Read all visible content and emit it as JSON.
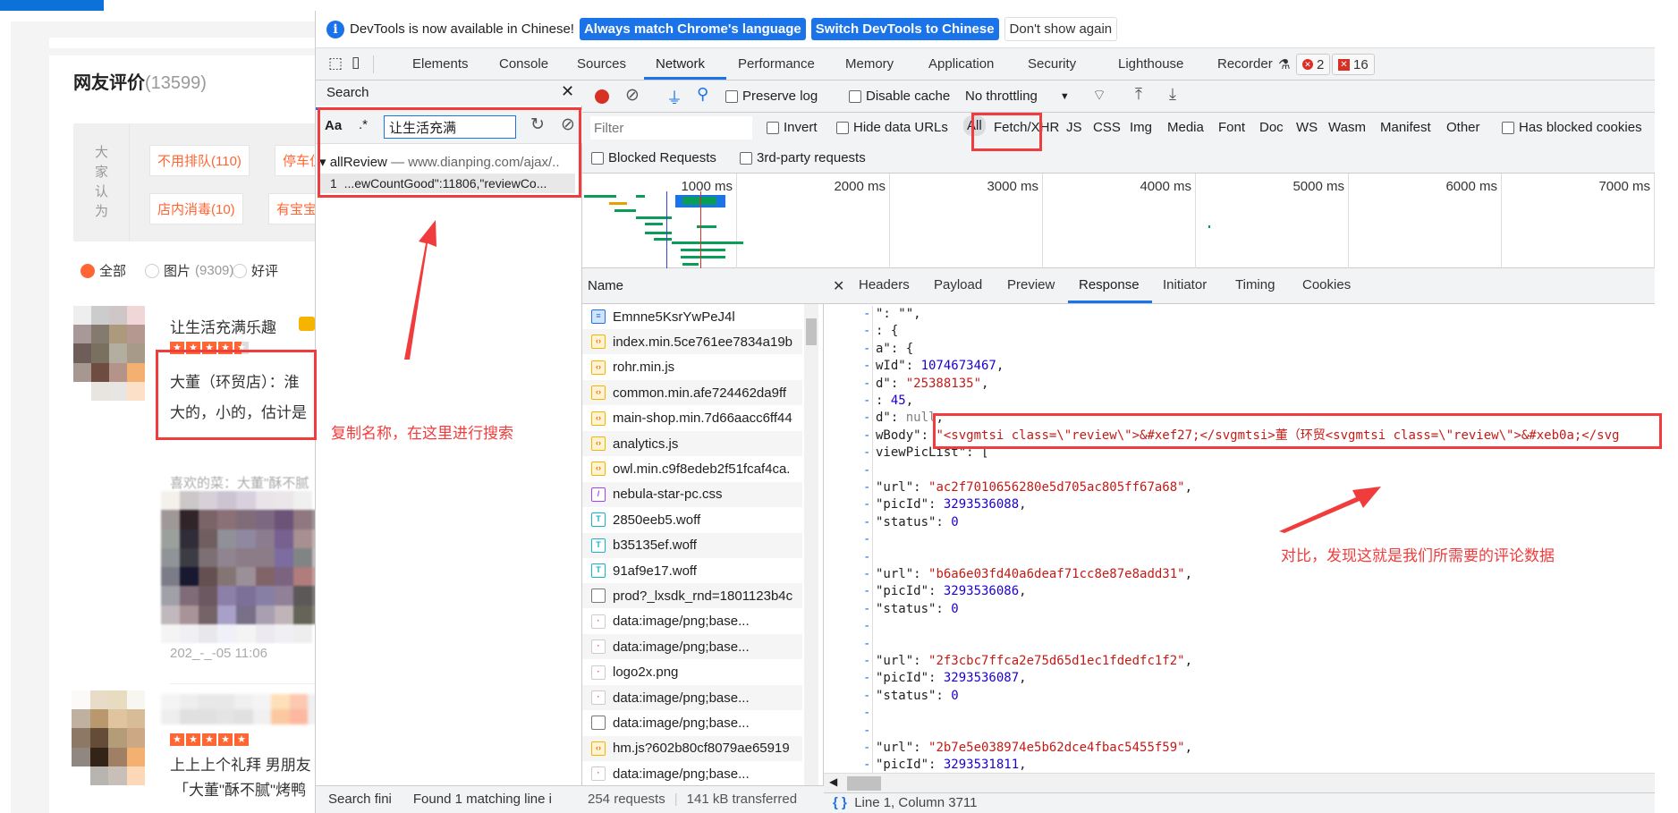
{
  "page": {
    "title": "网友评价",
    "count": "(13599)",
    "tag_label": "大家认为",
    "tags": [
      "不用排队(110)",
      "停车位",
      "店内消毒(10)",
      "有宝宝"
    ],
    "filters": [
      {
        "label": "全部",
        "count": "",
        "selected": true
      },
      {
        "label": "图片",
        "count": "(9309)",
        "selected": false
      },
      {
        "label": "好评",
        "count": "",
        "selected": false
      }
    ],
    "reviews": [
      {
        "user": "让生活充满乐趣",
        "rating": 4.5,
        "lines": [
          "大董（环贸店）：淮",
          "大的，小的，估计是"
        ],
        "dishes": "喜欢的菜：大董\"酥不腻",
        "date": "202_-_-05 11:06"
      },
      {
        "user": "",
        "rating": 5,
        "lines": [
          "上上上个礼拜 男朋友",
          "「大董\"酥不腻\"烤鸭"
        ]
      }
    ]
  },
  "devtools": {
    "infobar": {
      "message": "DevTools is now available in Chinese!",
      "btn_match": "Always match Chrome's language",
      "btn_switch": "Switch DevTools to Chinese",
      "btn_dismiss": "Don't show again"
    },
    "tabs": [
      "Elements",
      "Console",
      "Sources",
      "Network",
      "Performance",
      "Memory",
      "Application",
      "Security",
      "Lighthouse",
      "Recorder"
    ],
    "active_tab": "Network",
    "errors": "2",
    "issues": "16",
    "search": {
      "title": "Search",
      "case_label": "Aa",
      "regex_label": ".*",
      "query": "让生活充满",
      "result_file": "allReview",
      "result_url": "www.dianping.com/ajax/..",
      "match_line_no": "1",
      "match_text": "...ewCountGood\":11806,\"reviewCo...",
      "status_left": "Search fini",
      "status_right": "Found 1 matching line i"
    },
    "toolbar": {
      "preserve_log": "Preserve log",
      "disable_cache": "Disable cache",
      "throttling": "No throttling"
    },
    "filter": {
      "placeholder": "Filter",
      "invert": "Invert",
      "hide_data_urls": "Hide data URLs",
      "types": [
        "All",
        "Fetch/XHR",
        "JS",
        "CSS",
        "Img",
        "Media",
        "Font",
        "Doc",
        "WS",
        "Wasm",
        "Manifest",
        "Other"
      ],
      "active_type": "All",
      "has_blocked": "Has blocked cookies",
      "blocked_requests": "Blocked Requests",
      "third_party": "3rd-party requests"
    },
    "timeline_ticks": [
      "1000 ms",
      "2000 ms",
      "3000 ms",
      "4000 ms",
      "5000 ms",
      "6000 ms",
      "7000 ms"
    ],
    "requests": {
      "header": "Name",
      "rows": [
        {
          "name": "Emnne5KsrYwPeJ4l",
          "type": "doc"
        },
        {
          "name": "index.min.5ce761ee7834a19b",
          "type": "js"
        },
        {
          "name": "rohr.min.js",
          "type": "js"
        },
        {
          "name": "common.min.afe724462da9ff",
          "type": "js"
        },
        {
          "name": "main-shop.min.7d66aacc6ff44",
          "type": "js"
        },
        {
          "name": "analytics.js",
          "type": "js"
        },
        {
          "name": "owl.min.c9f8edeb2f51fcaf4ca.",
          "type": "js"
        },
        {
          "name": "nebula-star-pc.css",
          "type": "css"
        },
        {
          "name": "2850eeb5.woff",
          "type": "font"
        },
        {
          "name": "b35135ef.woff",
          "type": "font"
        },
        {
          "name": "91af9e17.woff",
          "type": "font"
        },
        {
          "name": "prod?_lxsdk_rnd=1801123b4c",
          "type": "blank"
        },
        {
          "name": "data:image/png;base...",
          "type": "img"
        },
        {
          "name": "data:image/png;base...",
          "type": "img"
        },
        {
          "name": "logo2x.png",
          "type": "img"
        },
        {
          "name": "data:image/png;base...",
          "type": "img"
        },
        {
          "name": "data:image/png;base...",
          "type": "blank"
        },
        {
          "name": "hm.js?602b80cf8079ae65919",
          "type": "js"
        },
        {
          "name": "data:image/png;base...",
          "type": "img"
        }
      ],
      "count": "254 requests",
      "transferred": "141 kB transferred"
    },
    "detail": {
      "tabs": [
        "Headers",
        "Payload",
        "Preview",
        "Response",
        "Initiator",
        "Timing",
        "Cookies"
      ],
      "active_tab": "Response",
      "lines": [
        [
          [
            "p",
            "\": \"\","
          ]
        ],
        [
          [
            "p",
            ": {"
          ]
        ],
        [
          [
            "p",
            "a\": {"
          ]
        ],
        [
          [
            "p",
            "wId\": "
          ],
          [
            "n",
            "1074673467"
          ],
          [
            "p",
            ","
          ]
        ],
        [
          [
            "p",
            "d\": "
          ],
          [
            "s",
            "\"25388135\""
          ],
          [
            "p",
            ","
          ]
        ],
        [
          [
            "p",
            ": "
          ],
          [
            "n",
            "45"
          ],
          [
            "p",
            ","
          ]
        ],
        [
          [
            "p",
            "d\": "
          ],
          [
            "u",
            "null"
          ],
          [
            "p",
            ","
          ]
        ],
        [
          [
            "p",
            "wBody\": "
          ],
          [
            "s",
            "\"<svgmtsi class=\\\"review\\\">&#xef27;</svgmtsi>董（环贸<svgmtsi class=\\\"review\\\">&#xeb0a;</svg"
          ]
        ],
        [
          [
            "p",
            "viewPicList\": ["
          ]
        ],
        [],
        [
          [
            "p",
            "  \"url\": "
          ],
          [
            "s",
            "\"ac2f7010656280e5d705ac805ff67a68\""
          ],
          [
            "p",
            ","
          ]
        ],
        [
          [
            "p",
            "  \"picId\": "
          ],
          [
            "n",
            "3293536088"
          ],
          [
            "p",
            ","
          ]
        ],
        [
          [
            "p",
            "  \"status\": "
          ],
          [
            "n",
            "0"
          ]
        ],
        [],
        [],
        [
          [
            "p",
            "  \"url\": "
          ],
          [
            "s",
            "\"b6a6e03fd40a6deaf71cc8e87e8add31\""
          ],
          [
            "p",
            ","
          ]
        ],
        [
          [
            "p",
            "  \"picId\": "
          ],
          [
            "n",
            "3293536086"
          ],
          [
            "p",
            ","
          ]
        ],
        [
          [
            "p",
            "  \"status\": "
          ],
          [
            "n",
            "0"
          ]
        ],
        [],
        [],
        [
          [
            "p",
            "  \"url\": "
          ],
          [
            "s",
            "\"2f3cbc7ffca2e75d65d1ec1fdedfc1f2\""
          ],
          [
            "p",
            ","
          ]
        ],
        [
          [
            "p",
            "  \"picId\": "
          ],
          [
            "n",
            "3293536087"
          ],
          [
            "p",
            ","
          ]
        ],
        [
          [
            "p",
            "  \"status\": "
          ],
          [
            "n",
            "0"
          ]
        ],
        [],
        [],
        [
          [
            "p",
            "  \"url\": "
          ],
          [
            "s",
            "\"2b7e5e038974e5b62dce4fbac5455f59\""
          ],
          [
            "p",
            ","
          ]
        ],
        [
          [
            "p",
            "  \"picId\": "
          ],
          [
            "n",
            "3293531811"
          ],
          [
            "p",
            ","
          ]
        ]
      ],
      "cursor": "Line 1, Column 3711"
    }
  },
  "annotations": {
    "note_search": "复制名称，在这里进行搜索",
    "note_compare": "对比，发现这就是我们所需要的评论数据",
    "color": "#f03c3c"
  }
}
